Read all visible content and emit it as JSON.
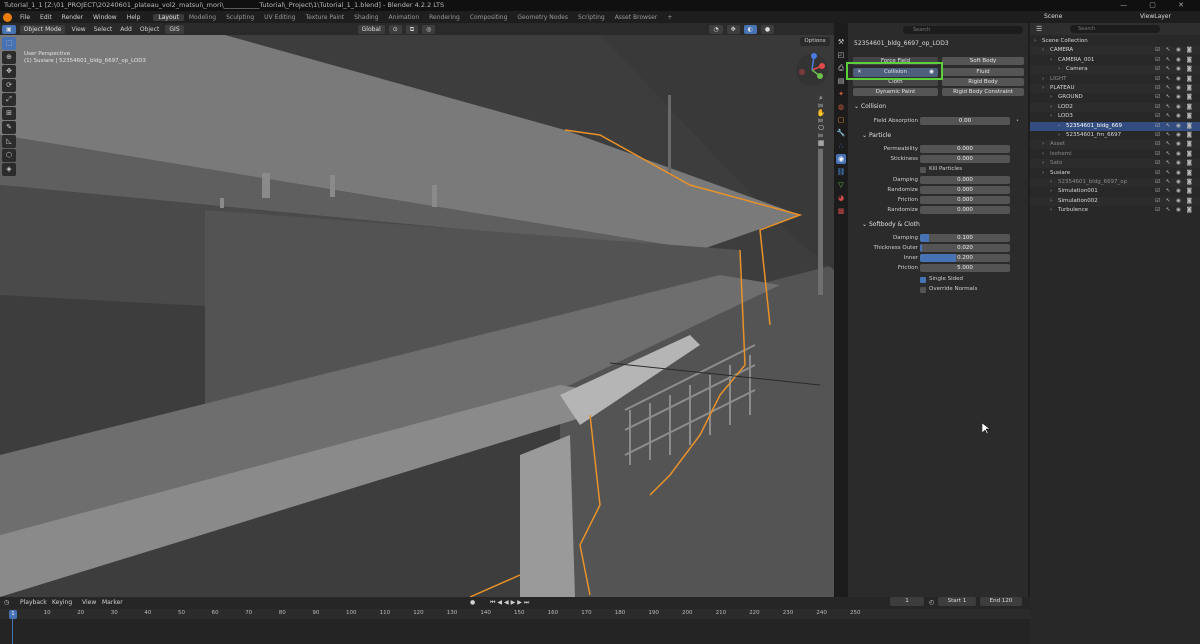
{
  "window": {
    "title": "Tutorial_1_1 [Z:\\01_PROJECT\\20240601_plateau_vol2_matsui\\_mori\\___________Tutorial\\_Project\\1\\Tutorial_1_1.blend] - Blender 4.2.2 LTS"
  },
  "menu": {
    "items": [
      "File",
      "Edit",
      "Render",
      "Window",
      "Help"
    ],
    "workspaces": [
      "Layout",
      "Modeling",
      "Sculpting",
      "UV Editing",
      "Texture Paint",
      "Shading",
      "Animation",
      "Rendering",
      "Compositing",
      "Geometry Nodes",
      "Scripting",
      "Asset Browser"
    ],
    "active_workspace": "Layout",
    "add_tab": "+"
  },
  "scene_bar": {
    "scene": "Scene",
    "view_layer": "ViewLayer"
  },
  "viewport_header": {
    "mode": "Object Mode",
    "menus": [
      "View",
      "Select",
      "Add",
      "Object"
    ],
    "gis": "GIS",
    "orientation": "Global"
  },
  "viewport": {
    "info_line1": "User Perspective",
    "info_line2": "(1) Susiare | 52354601_bldg_6697_op_LOD3",
    "options": "Options"
  },
  "tools": [
    "⬚",
    "⊕",
    "✥",
    "⟳",
    "⤢",
    "⊞",
    "✎",
    "◺",
    "⬡",
    "◈"
  ],
  "properties": {
    "search_placeholder": "Search",
    "object_name": "52354601_bldg_6697_op_LOD3",
    "physics_buttons": {
      "force_field": "Force Field",
      "soft_body": "Soft Body",
      "collision": "Collision",
      "fluid": "Fluid",
      "cloth": "Cloth",
      "rigid_body": "Rigid Body",
      "dynamic_paint": "Dynamic Paint",
      "rigid_body_constraint": "Rigid Body Constraint"
    },
    "collision_section": "Collision",
    "field_absorption_label": "Field Absorption",
    "field_absorption": "0.00",
    "particle_section": "Particle",
    "permeability_label": "Permeability",
    "permeability": "0.000",
    "stickiness_label": "Stickiness",
    "stickiness": "0.000",
    "kill_particles": "Kill Particles",
    "damping_label": "Damping",
    "damping": "0.000",
    "randomize_label": "Randomize",
    "randomize": "0.000",
    "friction_label": "Friction",
    "friction": "0.000",
    "randomize2_label": "Randomize",
    "randomize2": "0.000",
    "softbody_section": "Softbody & Cloth",
    "sb_damping_label": "Damping",
    "sb_damping": "0.100",
    "sb_damping_fill": 0.1,
    "thickness_outer_label": "Thickness Outer",
    "thickness_outer": "0.020",
    "thickness_outer_fill": 0.02,
    "inner_label": "Inner",
    "inner": "0.200",
    "inner_fill": 0.4,
    "sb_friction_label": "Friction",
    "sb_friction": "5.000",
    "sb_friction_fill": 0.0,
    "single_sided": "Single Sided",
    "override_normals": "Override Normals"
  },
  "outliner": {
    "search_placeholder": "Search",
    "rows": [
      {
        "label": "Scene Collection",
        "indent": 0,
        "color": "#d8d8d8"
      },
      {
        "label": "CAMERA",
        "indent": 1,
        "color": "#d8d8d8"
      },
      {
        "label": "CAMERA_001",
        "indent": 2,
        "color": "#d8d8d8"
      },
      {
        "label": "Camera",
        "indent": 3,
        "color": "#d8d8d8"
      },
      {
        "label": "LIGHT",
        "indent": 1,
        "color": "#8a8a8a"
      },
      {
        "label": "PLATEAU",
        "indent": 1,
        "color": "#d8d8d8"
      },
      {
        "label": "GROUND",
        "indent": 2,
        "color": "#d8d8d8"
      },
      {
        "label": "LOD2",
        "indent": 2,
        "color": "#d8d8d8"
      },
      {
        "label": "LOD3",
        "indent": 2,
        "color": "#d8d8d8"
      },
      {
        "label": "52354601_bldg_669",
        "indent": 3,
        "color": "#ffffff",
        "selected": true
      },
      {
        "label": "52354601_frn_6697",
        "indent": 3,
        "color": "#d8d8d8"
      },
      {
        "label": "Asset",
        "indent": 1,
        "color": "#8a8a8a"
      },
      {
        "label": "Isohemi",
        "indent": 1,
        "color": "#8a8a8a"
      },
      {
        "label": "Sato",
        "indent": 1,
        "color": "#8a8a8a"
      },
      {
        "label": "Susiare",
        "indent": 1,
        "color": "#d8d8d8"
      },
      {
        "label": "52354601_bldg_6697_op",
        "indent": 2,
        "color": "#8a8a8a"
      },
      {
        "label": "Simulation001",
        "indent": 2,
        "color": "#d8d8d8"
      },
      {
        "label": "Simulation002",
        "indent": 2,
        "color": "#d8d8d8"
      },
      {
        "label": "Turbulence",
        "indent": 2,
        "color": "#d8d8d8"
      }
    ]
  },
  "timeline": {
    "menus": [
      "Playback",
      "Keying",
      "View",
      "Marker"
    ],
    "current_frame": "1",
    "start_label": "Start",
    "start": "1",
    "end_label": "End",
    "end": "120",
    "ticks": [
      "0",
      "10",
      "20",
      "30",
      "40",
      "50",
      "60",
      "70",
      "80",
      "90",
      "100",
      "110",
      "120",
      "130",
      "140",
      "150",
      "160",
      "170",
      "180",
      "190",
      "200",
      "210",
      "220",
      "230",
      "240",
      "250"
    ]
  }
}
